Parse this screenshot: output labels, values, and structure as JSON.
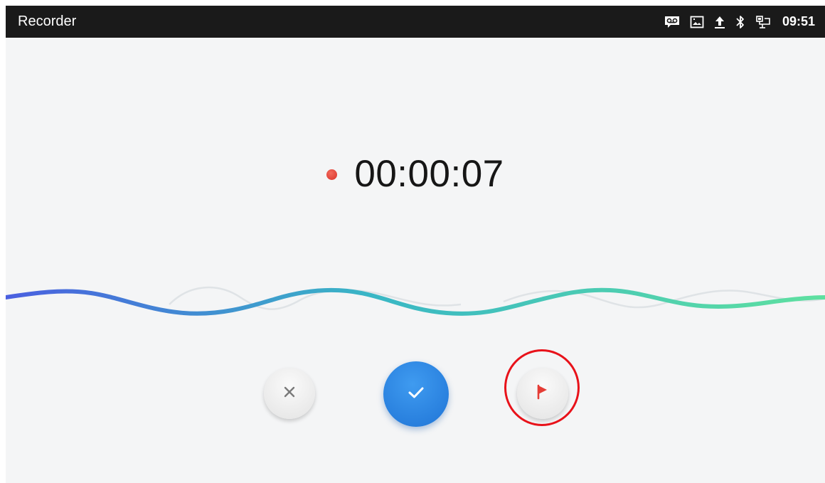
{
  "statusbar": {
    "title": "Recorder",
    "time": "09:51",
    "icons": [
      "voicemail-icon",
      "picture-icon",
      "upload-icon",
      "bluetooth-icon",
      "network-icon"
    ]
  },
  "recorder": {
    "elapsed": "00:00:07",
    "recording_indicator_color": "#e0392e"
  },
  "controls": {
    "cancel_icon": "close-icon",
    "done_icon": "check-icon",
    "flag_icon": "flag-icon"
  },
  "colors": {
    "wave_start": "#4a5fe0",
    "wave_mid": "#39b7c5",
    "wave_end": "#5ee0a0",
    "accent_blue": "#2a85e3",
    "flag_red": "#e53d36",
    "highlight_ring": "#e8121a",
    "statusbar_bg": "#1a1a1a"
  }
}
